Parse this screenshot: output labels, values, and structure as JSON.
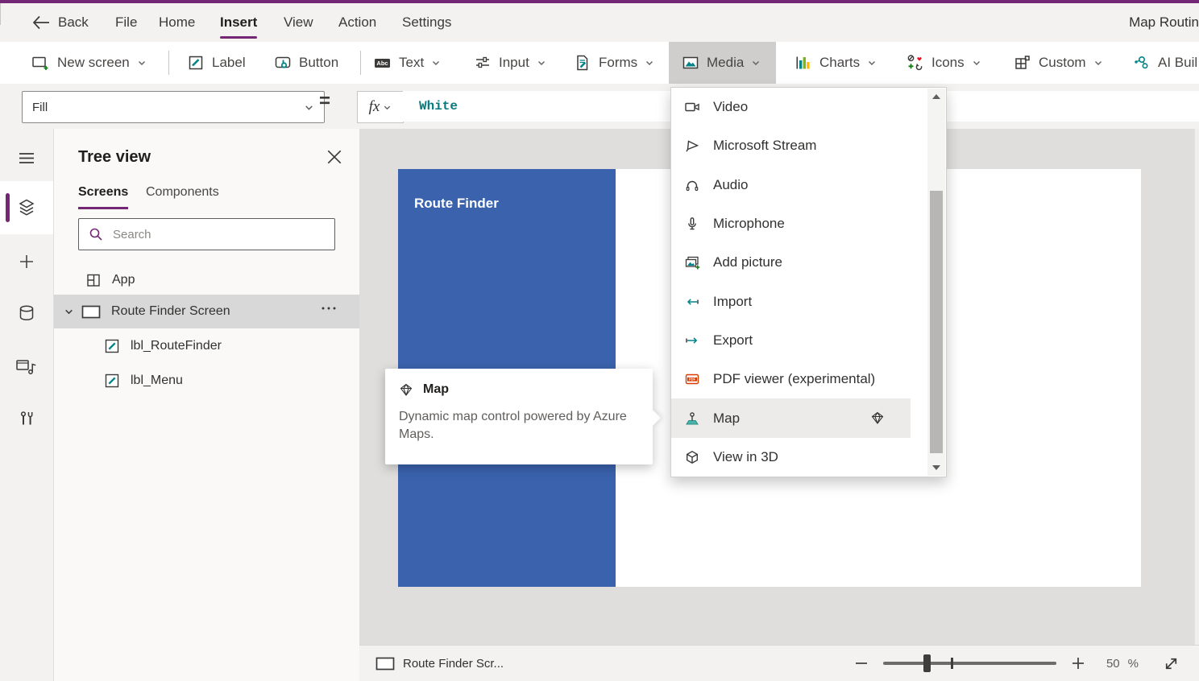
{
  "colors": {
    "accent_purple": "#742774",
    "teal": "#038387",
    "screen_blue": "#3A62AD",
    "formula_teal": "#077B80",
    "pdf_red": "#D83B01"
  },
  "top_menu": {
    "back_label": "Back",
    "items": [
      {
        "label": "File"
      },
      {
        "label": "Home"
      },
      {
        "label": "Insert"
      },
      {
        "label": "View"
      },
      {
        "label": "Action"
      },
      {
        "label": "Settings"
      }
    ],
    "active_item": "Insert",
    "app_title": "Map Routin"
  },
  "toolbar": {
    "buttons": [
      {
        "label": "New screen"
      },
      {
        "label": "Label"
      },
      {
        "label": "Button"
      },
      {
        "label": "Text"
      },
      {
        "label": "Input"
      },
      {
        "label": "Forms"
      },
      {
        "label": "Media"
      },
      {
        "label": "Charts"
      },
      {
        "label": "Icons"
      },
      {
        "label": "Custom"
      },
      {
        "label": "AI Buil"
      }
    ],
    "open_button": "Media"
  },
  "icon_texts": {
    "abc": "Abc",
    "pdf": "PDF"
  },
  "formula_bar": {
    "property_selector": "Fill",
    "equals_sign": "=",
    "fx_label": "fx",
    "formula_value": "White"
  },
  "tree_panel": {
    "title": "Tree view",
    "tabs": [
      {
        "label": "Screens"
      },
      {
        "label": "Components"
      }
    ],
    "active_tab": "Screens",
    "search_placeholder": "Search",
    "app_item": "App",
    "screen_item": "Route Finder Screen",
    "screen_children": [
      "lbl_RouteFinder",
      "lbl_Menu"
    ]
  },
  "canvas": {
    "screen_title": "Route Finder"
  },
  "media_menu": {
    "items": [
      {
        "label": "Video"
      },
      {
        "label": "Microsoft Stream"
      },
      {
        "label": "Audio"
      },
      {
        "label": "Microphone"
      },
      {
        "label": "Add picture"
      },
      {
        "label": "Import"
      },
      {
        "label": "Export"
      },
      {
        "label": "PDF viewer (experimental)"
      },
      {
        "label": "Map"
      },
      {
        "label": "View in 3D"
      }
    ],
    "selected_item": "Map"
  },
  "tooltip": {
    "title": "Map",
    "body": "Dynamic map control powered by Azure Maps."
  },
  "status_bar": {
    "screen_selector": "Route Finder Scr...",
    "zoom_value": "50",
    "zoom_unit": "%"
  }
}
